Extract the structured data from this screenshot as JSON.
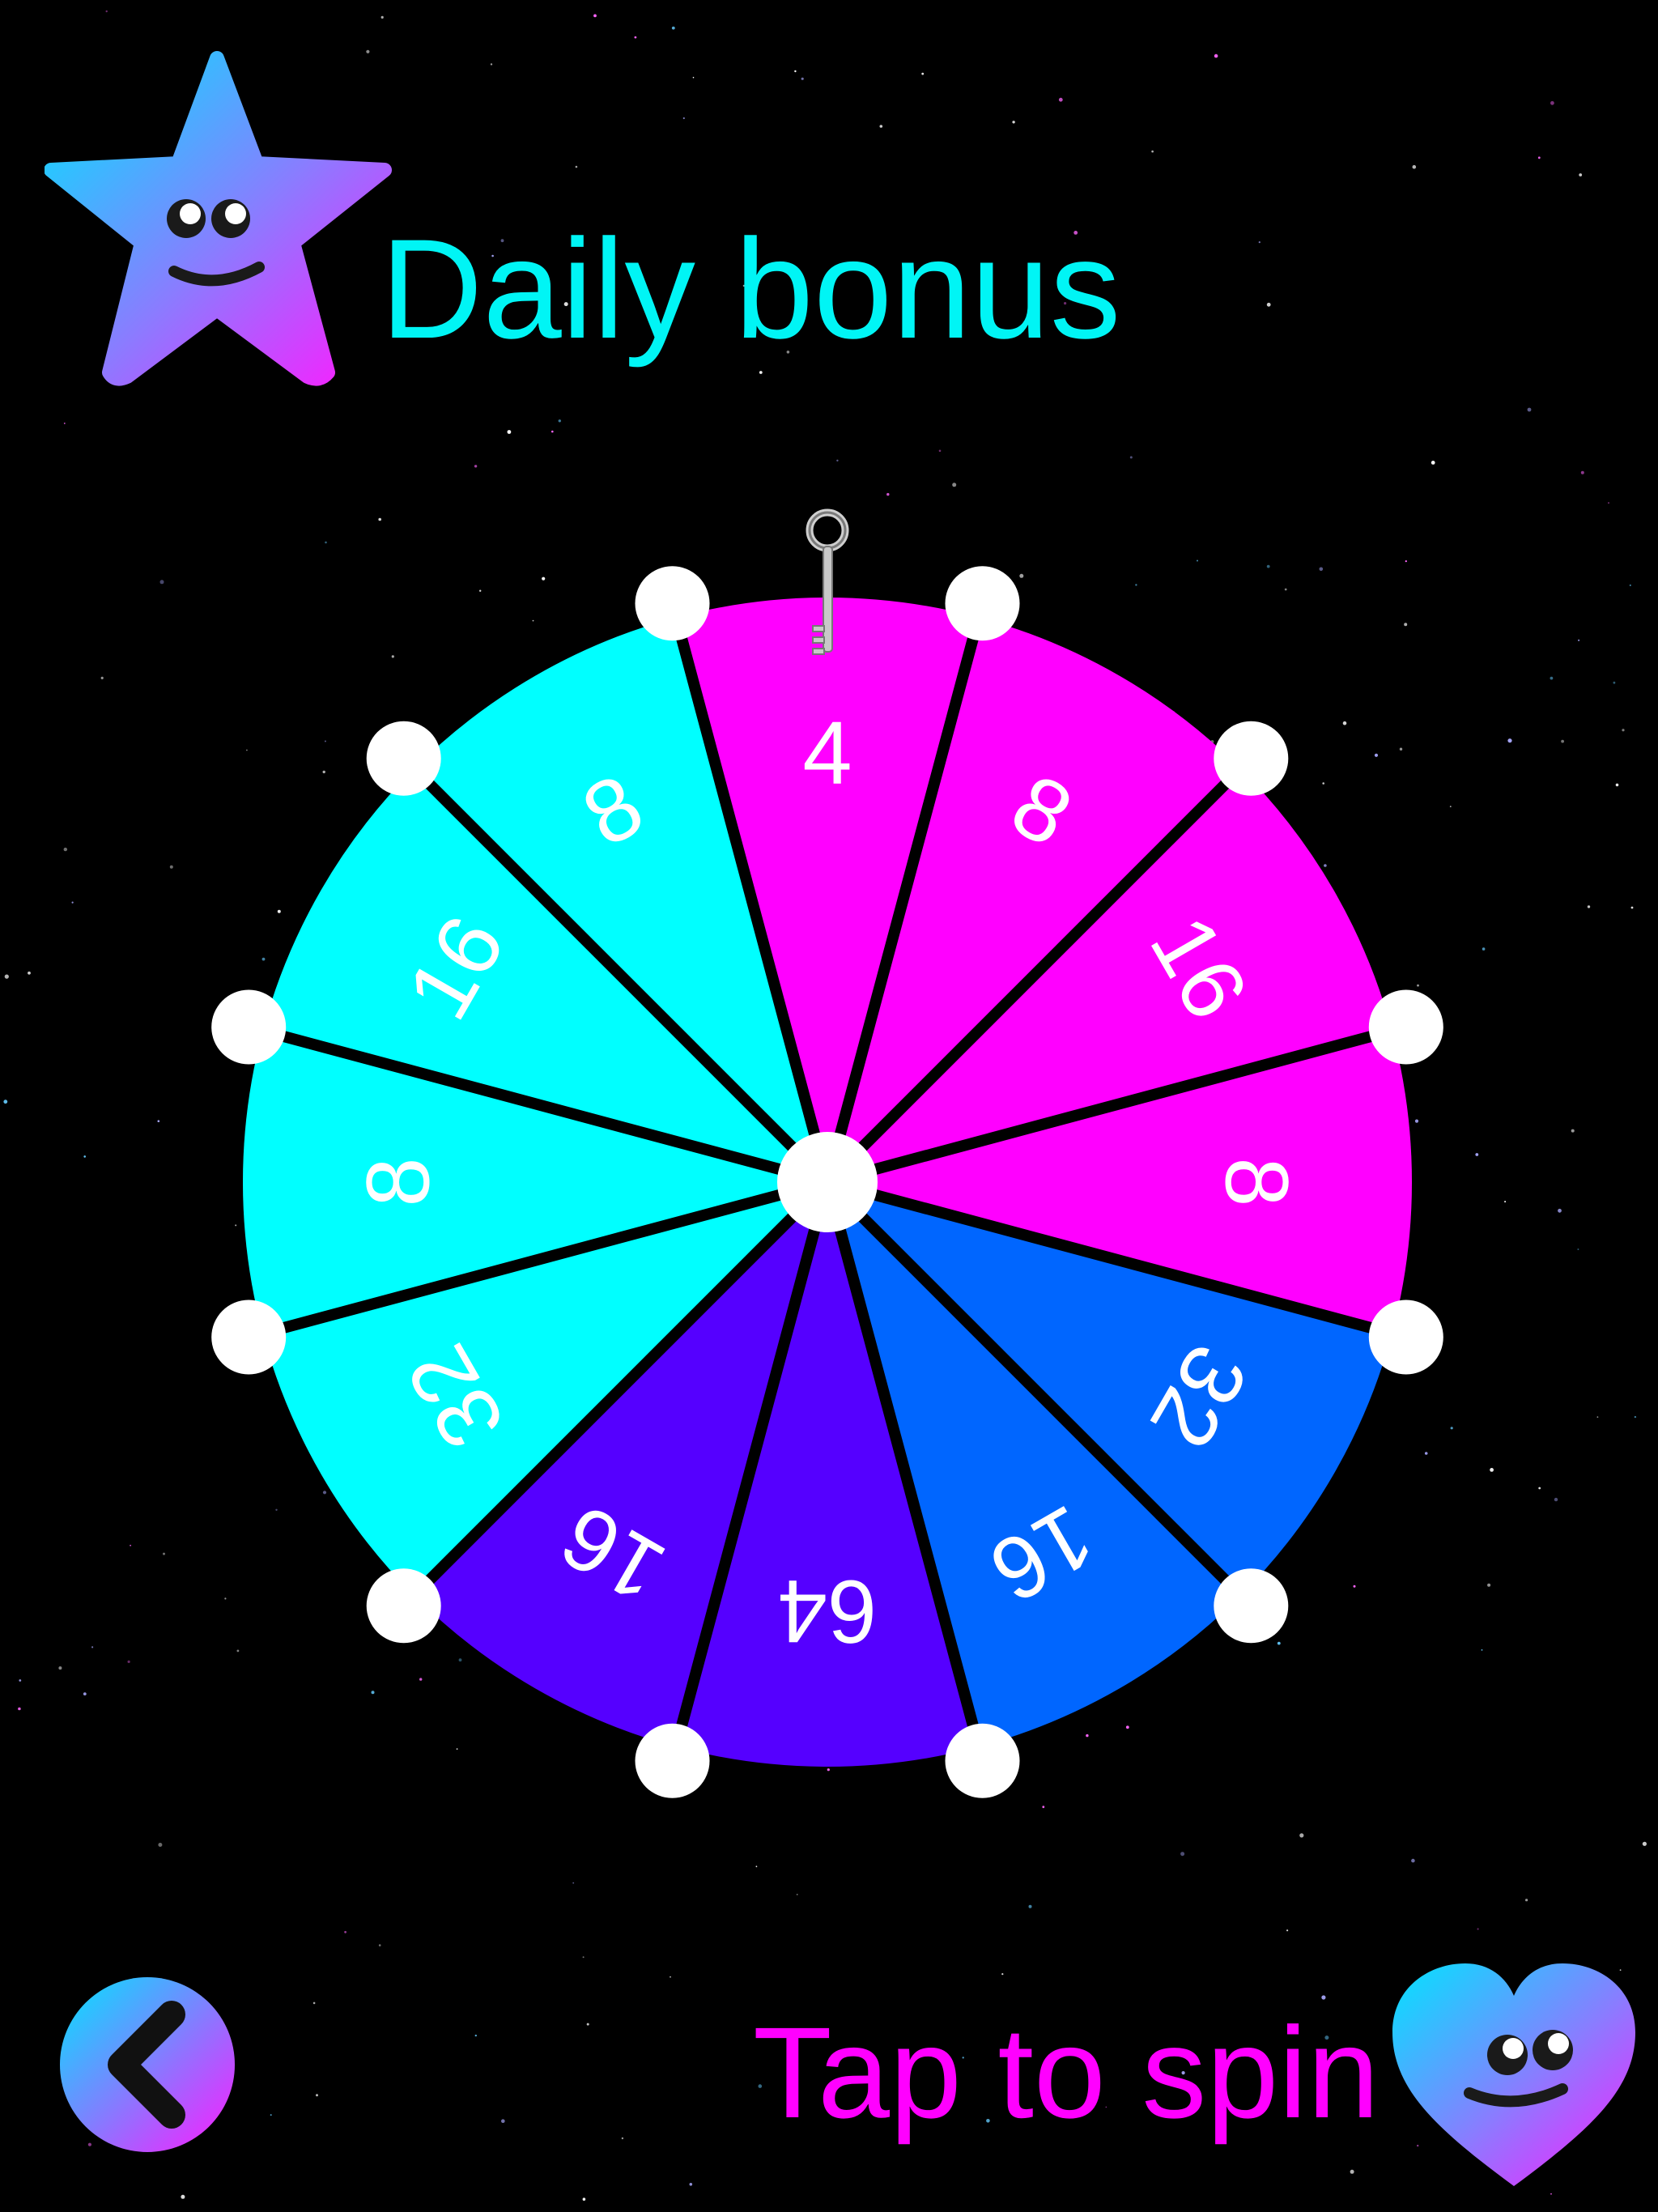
{
  "screen": {
    "title": "Daily bonus",
    "spin_label": "Tap to spin"
  },
  "icons": {
    "title_mascot": "smiling-star-icon",
    "back": "chevron-left-icon",
    "spin_mascot": "smiling-heart-icon",
    "pointer": "key-icon"
  },
  "colors": {
    "title": "#00f5f5",
    "spin_label": "#ff00ff",
    "segment_magenta": "#ff00ff",
    "segment_cyan": "#00ffff",
    "segment_blue": "#0066ff",
    "segment_violet": "#5500ff",
    "segment_divider": "#000000",
    "peg": "#ffffff"
  },
  "wheel": {
    "segments": [
      {
        "value": "4",
        "color": "#ff00ff"
      },
      {
        "value": "8",
        "color": "#ff00ff"
      },
      {
        "value": "16",
        "color": "#ff00ff"
      },
      {
        "value": "8",
        "color": "#ff00ff"
      },
      {
        "value": "32",
        "color": "#0066ff"
      },
      {
        "value": "16",
        "color": "#0066ff"
      },
      {
        "value": "64",
        "color": "#5500ff"
      },
      {
        "value": "16",
        "color": "#5500ff"
      },
      {
        "value": "32",
        "color": "#00ffff"
      },
      {
        "value": "8",
        "color": "#00ffff"
      },
      {
        "value": "16",
        "color": "#00ffff"
      },
      {
        "value": "8",
        "color": "#00ffff"
      }
    ]
  }
}
